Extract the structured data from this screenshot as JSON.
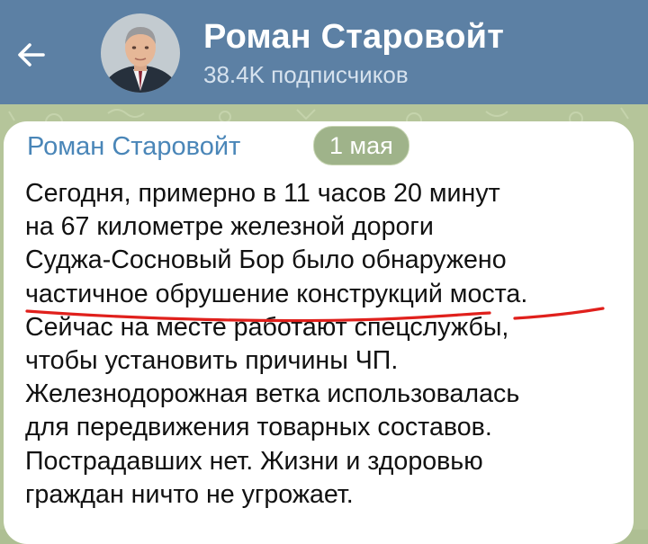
{
  "header": {
    "title": "Роман Старовойт",
    "subtitle": "38.4K подписчиков",
    "back_icon": "arrow-left-icon",
    "background_color": "#5c80a4"
  },
  "message": {
    "sender": "Роман Старовойт",
    "date": "1 мая",
    "lines": [
      "Сегодня, примерно в 11 часов 20 минут",
      "на 67 километре железной дороги",
      "Суджа-Сосновый Бор было обнаружено",
      "частичное обрушение конструкций моста.",
      "Сейчас на месте работают спецслужбы,",
      "чтобы установить причины ЧП.",
      "Железнодорожная ветка использовалась",
      "для передвижения товарных составов.",
      "Пострадавших нет. Жизни и здоровью",
      "граждан ничто не угрожает."
    ],
    "highlight_color": "#e0201c"
  }
}
